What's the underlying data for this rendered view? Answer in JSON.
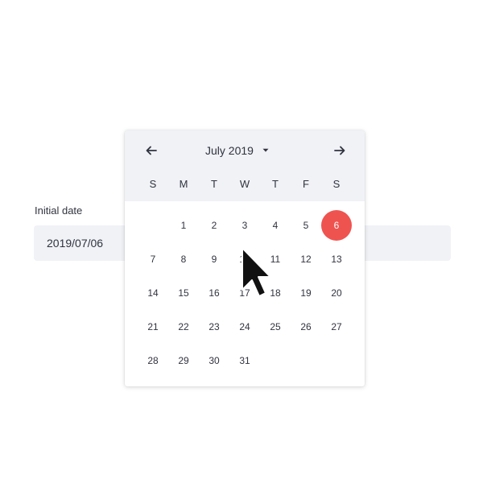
{
  "field": {
    "label": "Initial date",
    "value": "2019/07/06"
  },
  "calendar": {
    "month_label": "July 2019",
    "prev_icon": "arrow-left-icon",
    "next_icon": "arrow-right-icon",
    "dropdown_icon": "caret-down-icon",
    "weekdays": [
      "S",
      "M",
      "T",
      "W",
      "T",
      "F",
      "S"
    ],
    "leading_blanks": 1,
    "days": [
      "1",
      "2",
      "3",
      "4",
      "5",
      "6",
      "7",
      "8",
      "9",
      "10",
      "11",
      "12",
      "13",
      "14",
      "15",
      "16",
      "17",
      "18",
      "19",
      "20",
      "21",
      "22",
      "23",
      "24",
      "25",
      "26",
      "27",
      "28",
      "29",
      "30",
      "31"
    ],
    "selected_day": "6",
    "accent_color": "#ef5350",
    "header_bg": "#f0f2f6"
  },
  "cursor": {
    "icon": "mouse-pointer-icon"
  }
}
